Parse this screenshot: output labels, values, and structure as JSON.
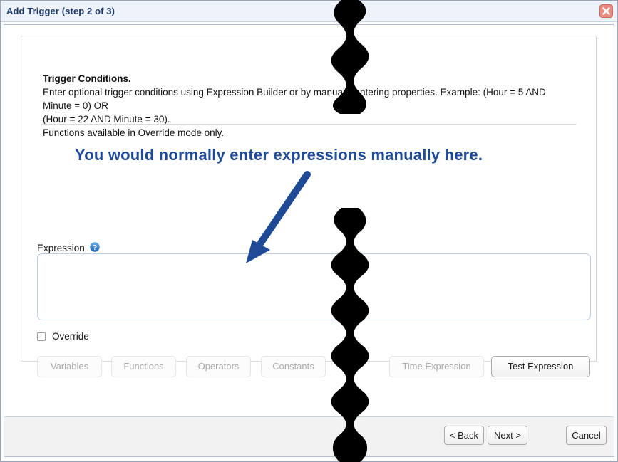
{
  "window": {
    "title": "Add Trigger (step 2 of 3)",
    "close_icon": "close-icon"
  },
  "instructions": {
    "heading": "Trigger Conditions.",
    "line1": "Enter optional trigger conditions using Expression Builder or by manually entering properties. Example: (Hour = 5 AND Minute = 0) OR",
    "line2": "(Hour = 22 AND Minute = 30).",
    "line3": "Functions available in Override mode only."
  },
  "expression": {
    "label": "Expression",
    "help_icon": "help-icon",
    "value": "",
    "placeholder": ""
  },
  "override": {
    "label": "Override",
    "checked": false
  },
  "toolbar": {
    "buttons": [
      {
        "label": "Variables",
        "enabled": false
      },
      {
        "label": "Functions",
        "enabled": false
      },
      {
        "label": "Operators",
        "enabled": false
      },
      {
        "label": "Constants",
        "enabled": false
      },
      {
        "label": "Time Expression",
        "enabled": false
      },
      {
        "label": "Test Expression",
        "enabled": true
      }
    ]
  },
  "footer": {
    "back_label": "< Back",
    "next_label": "Next >",
    "cancel_label": "Cancel"
  },
  "annotation": {
    "text": "You would normally enter expressions manually here.",
    "color": "#1f4a96",
    "arrow": "down-left-arrow"
  },
  "redaction": {
    "color": "#000000",
    "description": "wavy vertical black redaction band"
  }
}
